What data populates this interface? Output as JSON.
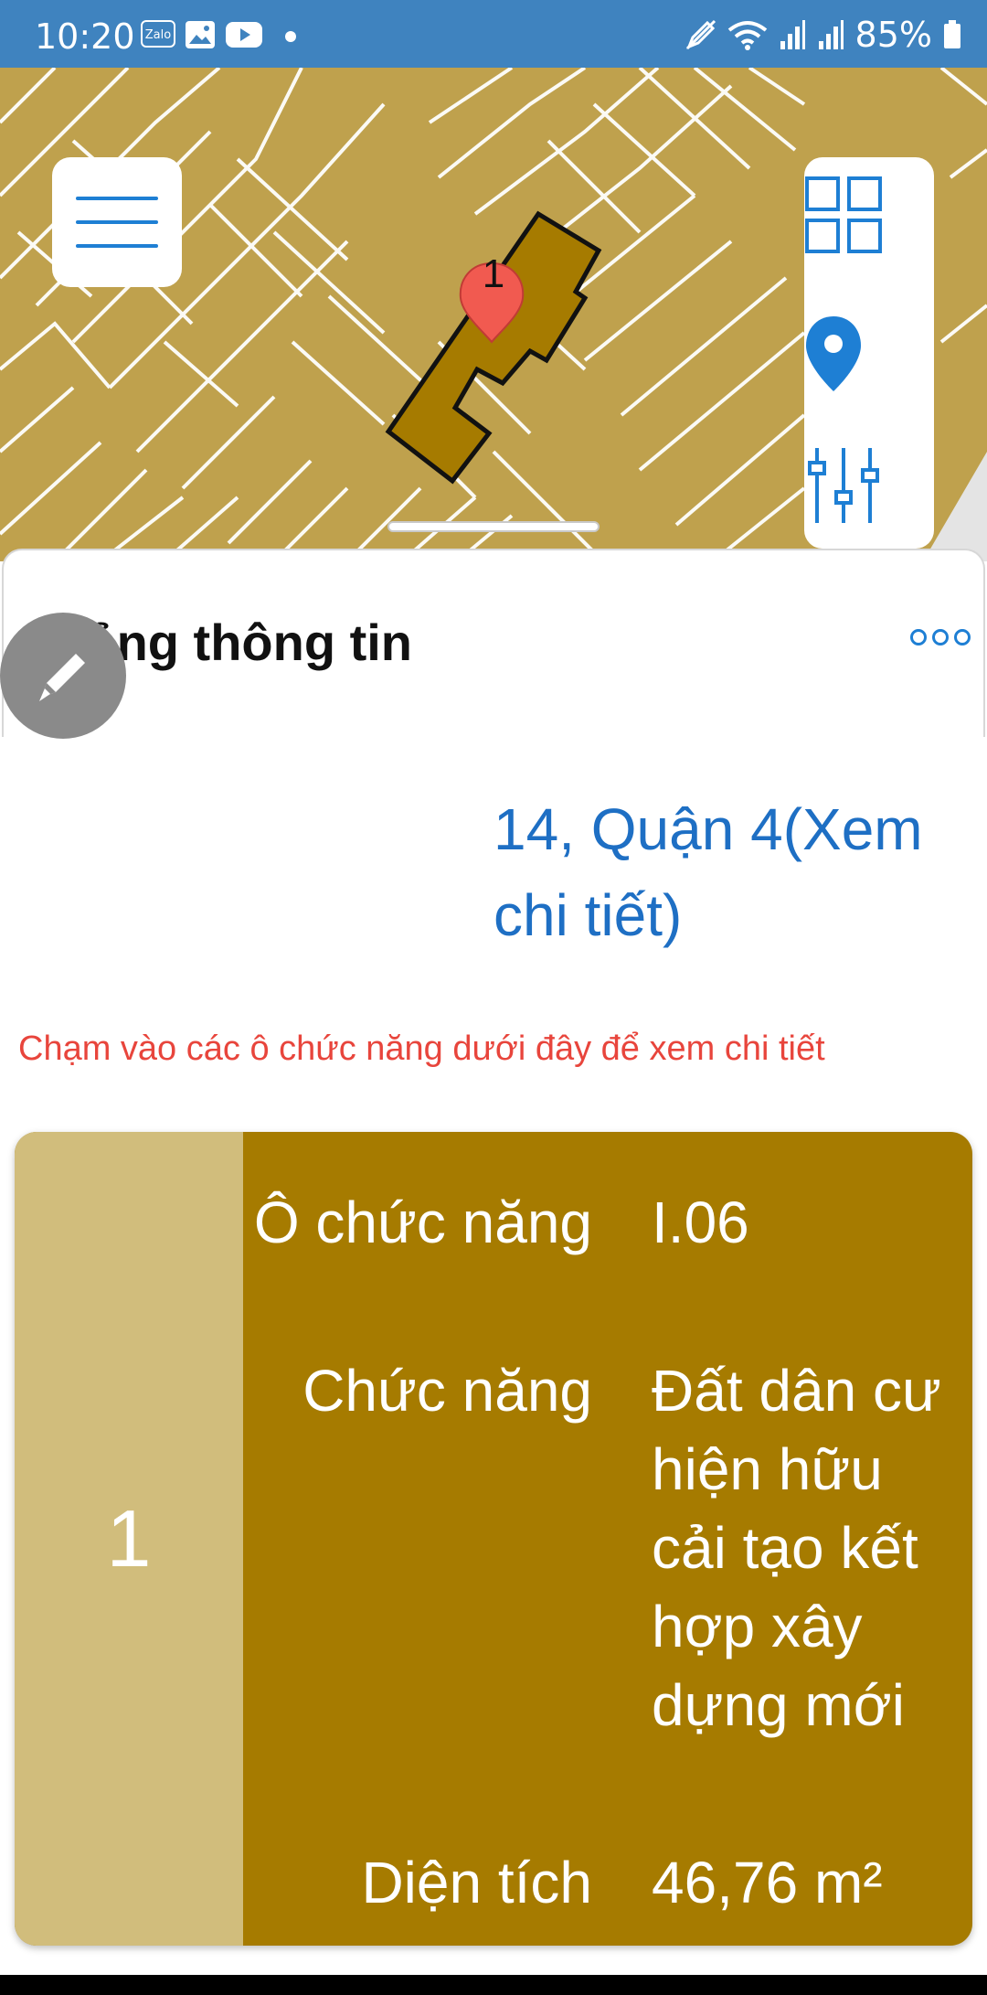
{
  "status_bar": {
    "time": "10:20",
    "notif_zalo": "Zalo",
    "battery": "85%"
  },
  "map": {
    "marker_label": "1",
    "colors": {
      "land": "#bfa14d",
      "parcel": "#a67b00",
      "accent": "#1e7fd4"
    }
  },
  "sheet": {
    "title": "Bảng thông tin",
    "address_lines": [
      "14, Quận 4(Xem",
      "chi tiết)"
    ],
    "hint": "Chạm vào các ô chức năng dưới đây để xem chi tiết"
  },
  "card": {
    "index": "1",
    "rows": [
      {
        "key": "Ô chức năng",
        "value": "I.06"
      },
      {
        "key": "Chức năng",
        "value": "Đất dân cư hiện hữu cải tạo kết hợp xây dựng mới"
      },
      {
        "key": "Diện tích",
        "value": "46,76 m²"
      }
    ]
  }
}
